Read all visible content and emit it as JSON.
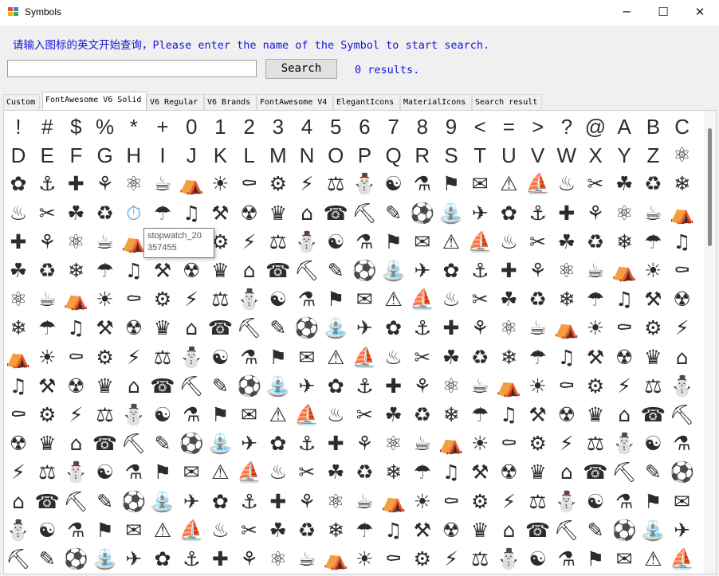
{
  "window": {
    "title": "Symbols",
    "minimize": "─",
    "maximize": "☐",
    "close": "✕"
  },
  "prompt": "请输入图标的英文开始查询，Please enter the name of the Symbol to start search.",
  "search": {
    "value": "",
    "button_label": "Search",
    "results_text": "0 results."
  },
  "tabs": [
    "Custom",
    "FontAwesome V6 Solid",
    "V6 Regular",
    "V6 Brands",
    "FontAwesome V4",
    "ElegantIcons",
    "MaterialIcons",
    "Search result"
  ],
  "active_tab": 1,
  "tooltip": {
    "line1": "stopwatch_20",
    "line2": "357455"
  },
  "grid": {
    "row_chars": [
      "!",
      "#",
      "$",
      "%",
      "*",
      "+",
      "0",
      "1",
      "2",
      "3",
      "4",
      "5",
      "6",
      "7",
      "8",
      "9",
      "<",
      "=",
      ">",
      "?",
      "@",
      "A",
      "B",
      "C",
      "D",
      "E",
      "F",
      "G",
      "H",
      "I",
      "J",
      "K",
      "L",
      "M",
      "N",
      "O",
      "P",
      "Q",
      "R",
      "S",
      "T",
      "U",
      "V",
      "W",
      "X",
      "Y",
      "Z"
    ],
    "icon_glyphs": [
      "⛲",
      "⌂",
      "☂",
      "♨",
      "⚗",
      "⚙",
      "⚛",
      "✈",
      "☎",
      "♫",
      "✂",
      "⚑",
      "⚡",
      "☕",
      "✿",
      "⛏",
      "⚒",
      "☘",
      "✉",
      "⚖",
      "⛺",
      "⚓",
      "✎",
      "☢",
      "♻",
      "⚠",
      "⛄",
      "☀",
      "✚",
      "⚽",
      "♛",
      "❄",
      "⛵",
      "☯",
      "⚰",
      "⚘"
    ]
  },
  "colors": {
    "prompt": "#1515d8",
    "highlight": "#4ba3ee",
    "icon": "#2c2c2c"
  }
}
